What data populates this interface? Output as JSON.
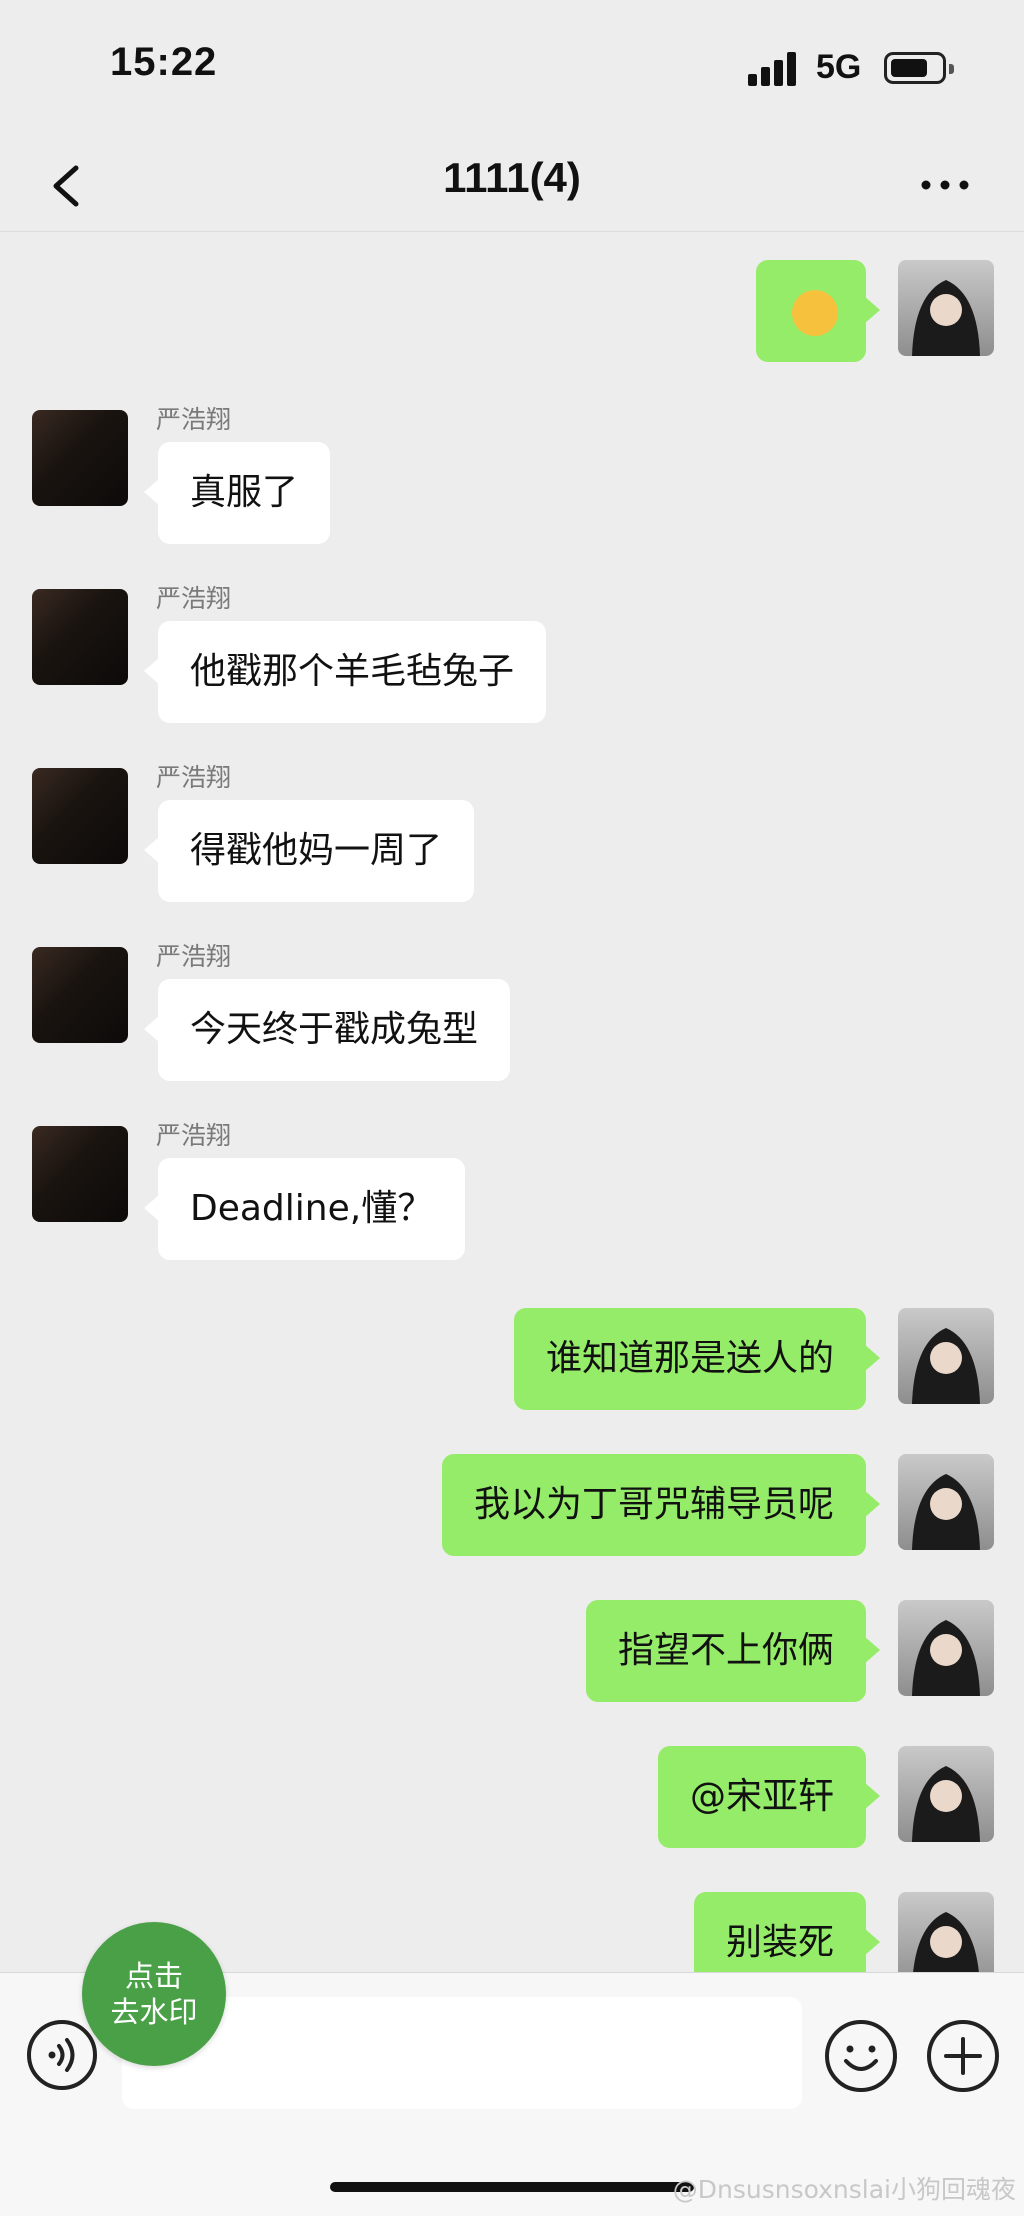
{
  "status_bar": {
    "time": "15:22",
    "network": "5G"
  },
  "nav": {
    "title": "1111(4)"
  },
  "messages": [
    {
      "side": "out",
      "type": "sticker",
      "text": ""
    },
    {
      "side": "in",
      "sender": "严浩翔",
      "text": "真服了"
    },
    {
      "side": "in",
      "sender": "严浩翔",
      "text": "他戳那个羊毛毡兔子"
    },
    {
      "side": "in",
      "sender": "严浩翔",
      "text": "得戳他妈一周了"
    },
    {
      "side": "in",
      "sender": "严浩翔",
      "text": "今天终于戳成兔型"
    },
    {
      "side": "in",
      "sender": "严浩翔",
      "text": "Deadline,懂？"
    },
    {
      "side": "out",
      "text": "谁知道那是送人的"
    },
    {
      "side": "out",
      "text": "我以为丁哥咒辅导员呢"
    },
    {
      "side": "out",
      "text": "指望不上你俩"
    },
    {
      "side": "out",
      "text": "@宋亚轩"
    },
    {
      "side": "out",
      "text": "别装死"
    }
  ],
  "overlay": {
    "watermark_line1": "点击",
    "watermark_line2": "去水印",
    "credit": "@Dnsusnsoxnslai小狗回魂夜"
  },
  "colors": {
    "out_bubble": "#95ec69",
    "in_bubble": "#ffffff",
    "background": "#ededed",
    "watermark_button": "#4aa047"
  }
}
